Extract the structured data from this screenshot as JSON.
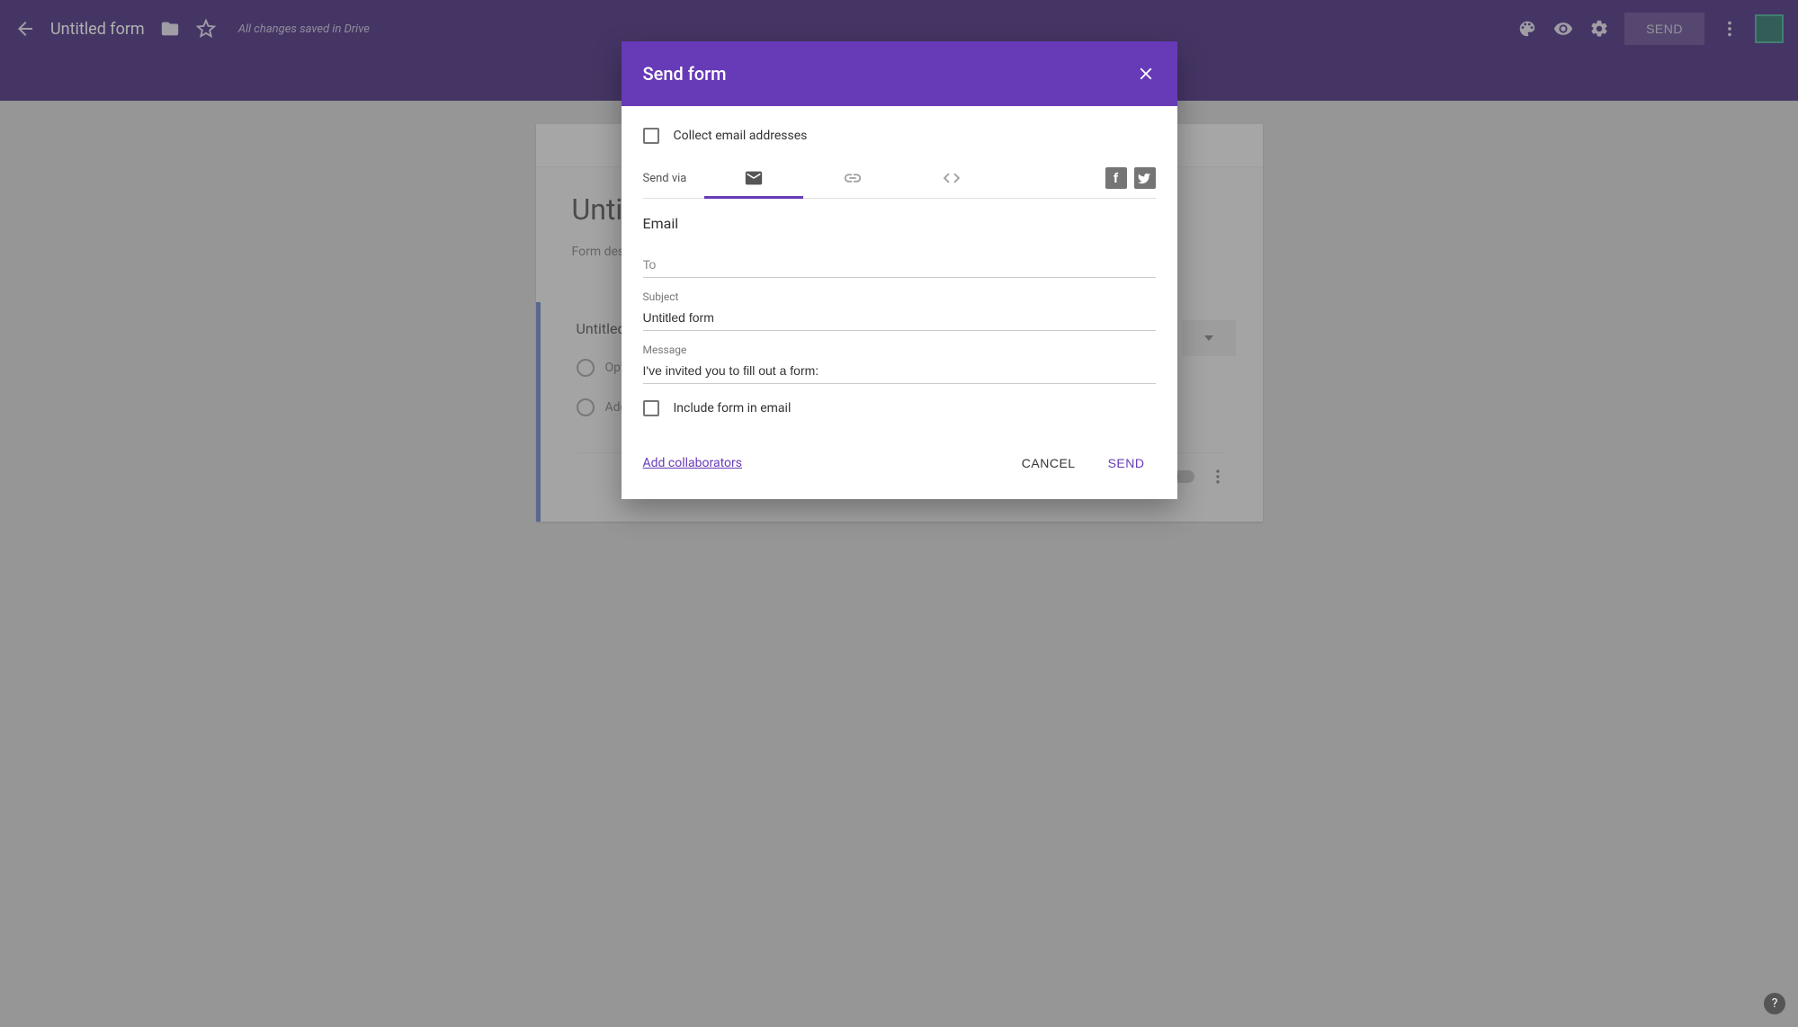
{
  "header": {
    "title": "Untitled form",
    "save_status": "All changes saved in Drive",
    "send_label": "SEND"
  },
  "form": {
    "title": "Untitled form",
    "description_placeholder": "Form description",
    "question_title": "Untitled Question",
    "option1": "Option 1",
    "add_option": "Add option"
  },
  "dialog": {
    "title": "Send form",
    "collect_emails_label": "Collect email addresses",
    "send_via_label": "Send via",
    "section_title": "Email",
    "to_placeholder": "To",
    "to_value": "",
    "subject_label": "Subject",
    "subject_value": "Untitled form",
    "message_label": "Message",
    "message_value": "I've invited you to fill out a form:",
    "include_form_label": "Include form in email",
    "add_collaborators": "Add collaborators",
    "cancel_label": "CANCEL",
    "send_label": "SEND"
  }
}
